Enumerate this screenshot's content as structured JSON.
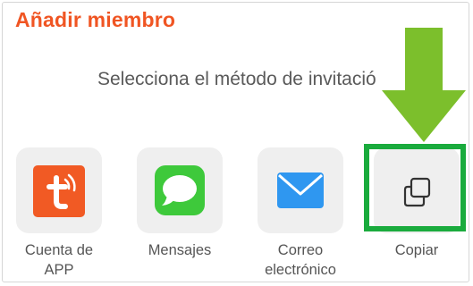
{
  "dialog": {
    "title": "Añadir miembro",
    "subtitle": "Selecciona el método de invitació"
  },
  "options": [
    {
      "label_line1": "Cuenta de",
      "label_line2": "APP",
      "icon": "app-logo-icon"
    },
    {
      "label_line1": "Mensajes",
      "label_line2": "",
      "icon": "message-bubble-icon"
    },
    {
      "label_line1": "Correo",
      "label_line2": "electrónico",
      "icon": "envelope-icon"
    },
    {
      "label_line1": "Copiar",
      "label_line2": "",
      "icon": "copy-icon"
    }
  ],
  "colors": {
    "title": "#f05523",
    "app_icon_bg": "#f15a24",
    "messages_green": "#3ec93b",
    "mail_blue": "#2f97f0",
    "highlight_green": "#1aab3d",
    "arrow_green": "#7cbf2c"
  }
}
